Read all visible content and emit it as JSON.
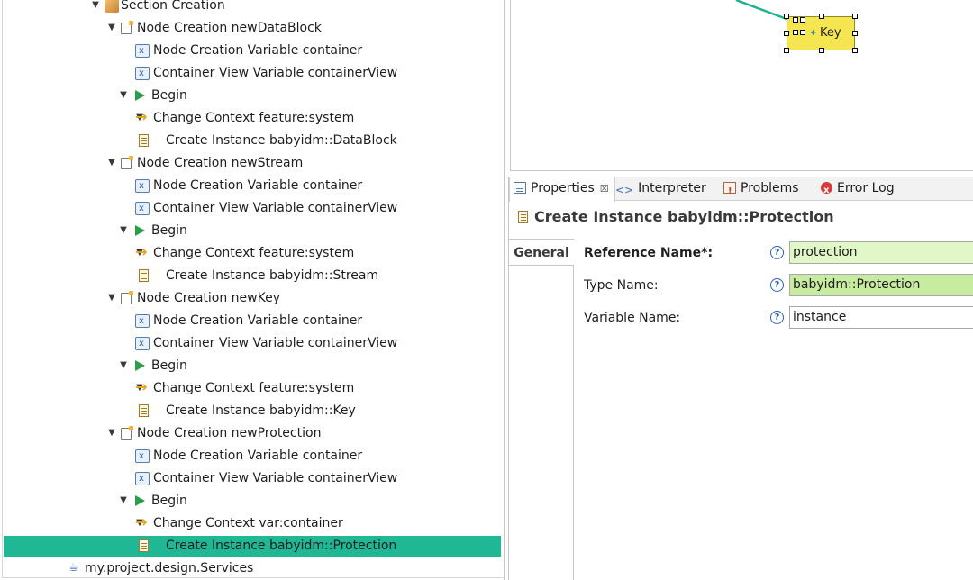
{
  "tree": {
    "rows": [
      {
        "label": "Section Creation",
        "icon": "section-icon",
        "expanded": true
      },
      {
        "label": "Node Creation newDataBlock",
        "icon": "node-creation-icon",
        "expanded": true
      },
      {
        "label": "Node Creation Variable container",
        "icon": "variable-icon"
      },
      {
        "label": "Container View Variable containerView",
        "icon": "variable-icon"
      },
      {
        "label": "Begin",
        "icon": "begin-icon",
        "expanded": true
      },
      {
        "label": "Change Context feature:system",
        "icon": "change-context-icon",
        "expanded": true
      },
      {
        "label": "Create Instance babyidm::DataBlock",
        "icon": "create-instance-icon"
      },
      {
        "label": "Node Creation newStream",
        "icon": "node-creation-icon",
        "expanded": true
      },
      {
        "label": "Node Creation Variable container",
        "icon": "variable-icon"
      },
      {
        "label": "Container View Variable containerView",
        "icon": "variable-icon"
      },
      {
        "label": "Begin",
        "icon": "begin-icon",
        "expanded": true
      },
      {
        "label": "Change Context feature:system",
        "icon": "change-context-icon",
        "expanded": true
      },
      {
        "label": "Create Instance babyidm::Stream",
        "icon": "create-instance-icon"
      },
      {
        "label": "Node Creation newKey",
        "icon": "node-creation-icon",
        "expanded": true
      },
      {
        "label": "Node Creation Variable container",
        "icon": "variable-icon"
      },
      {
        "label": "Container View Variable containerView",
        "icon": "variable-icon"
      },
      {
        "label": "Begin",
        "icon": "begin-icon",
        "expanded": true
      },
      {
        "label": "Change Context feature:system",
        "icon": "change-context-icon",
        "expanded": true
      },
      {
        "label": "Create Instance babyidm::Key",
        "icon": "create-instance-icon"
      },
      {
        "label": "Node Creation newProtection",
        "icon": "node-creation-icon",
        "expanded": true
      },
      {
        "label": "Node Creation Variable container",
        "icon": "variable-icon"
      },
      {
        "label": "Container View Variable containerView",
        "icon": "variable-icon"
      },
      {
        "label": "Begin",
        "icon": "begin-icon",
        "expanded": true
      },
      {
        "label": "Change Context var:container",
        "icon": "change-context-icon",
        "expanded": true
      },
      {
        "label": "Create Instance babyidm::Protection",
        "icon": "create-instance-icon",
        "selected": true
      },
      {
        "label": "my.project.design.Services",
        "icon": "java-services-icon"
      }
    ],
    "selected_color": "#20b795"
  },
  "diagram": {
    "node_label": "Key",
    "node_color": "#f5e651",
    "edge_color": "#1fb28f"
  },
  "properties": {
    "tabs": [
      {
        "label": "Properties",
        "icon": "properties-icon",
        "active": true
      },
      {
        "label": "Interpreter",
        "icon": "interpreter-icon"
      },
      {
        "label": "Problems",
        "icon": "problems-icon"
      },
      {
        "label": "Error Log",
        "icon": "error-log-icon"
      }
    ],
    "close_glyph": "☒",
    "title": "Create Instance babyidm::Protection",
    "side_tab": "General",
    "fields": [
      {
        "label": "Reference Name*:",
        "value": "protection",
        "required": true
      },
      {
        "label": "Type Name:",
        "value": "babyidm::Protection"
      },
      {
        "label": "Variable Name:",
        "value": "instance"
      }
    ],
    "help_glyph": "?"
  }
}
